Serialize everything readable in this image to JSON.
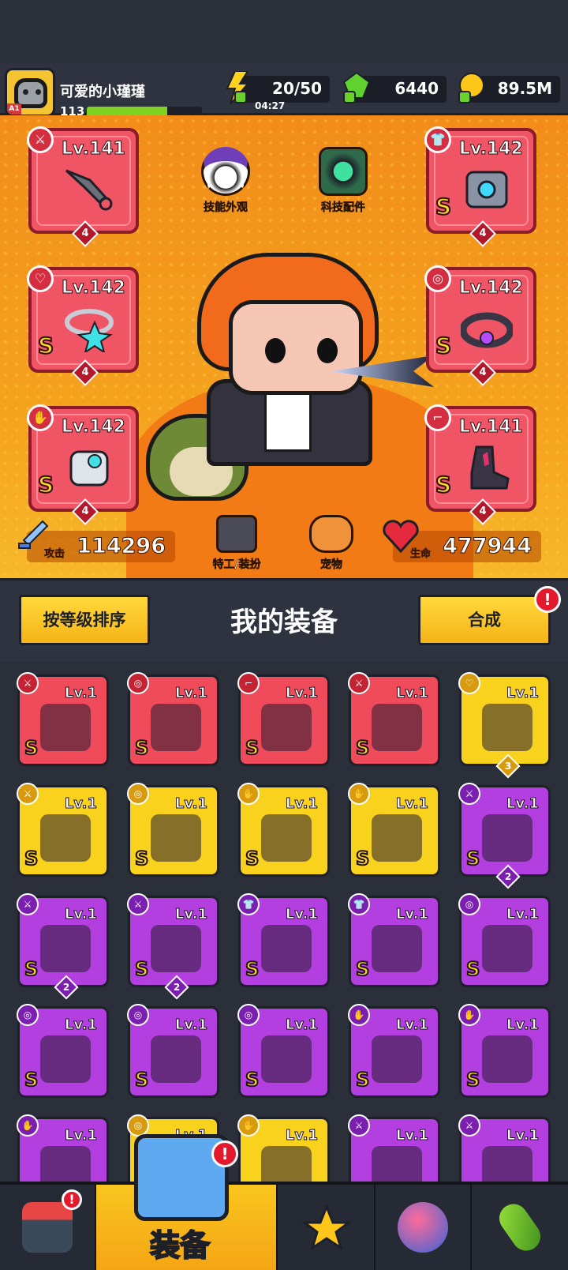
{
  "player": {
    "name": "可爱的小瑾瑾",
    "level": "113",
    "badge": "A1",
    "xp_fraction": 0.7
  },
  "resources": {
    "energy": {
      "value": "20/50",
      "timer": "04:27"
    },
    "gems": {
      "value": "6440"
    },
    "coins": {
      "value": "89.5M"
    }
  },
  "hero_buttons": {
    "skill_skin": "技能外观",
    "tech_parts": "科技配件",
    "agent_outfit": "特工/装扮",
    "pet": "宠物"
  },
  "equipped": [
    {
      "slot": "weapon",
      "level": "Lv.141",
      "stars": "4",
      "rank": ""
    },
    {
      "slot": "armor",
      "level": "Lv.142",
      "stars": "4",
      "rank": "S"
    },
    {
      "slot": "necklace",
      "level": "Lv.142",
      "stars": "4",
      "rank": "S"
    },
    {
      "slot": "belt",
      "level": "Lv.142",
      "stars": "4",
      "rank": "S"
    },
    {
      "slot": "gloves",
      "level": "Lv.142",
      "stars": "4",
      "rank": "S"
    },
    {
      "slot": "boots",
      "level": "Lv.141",
      "stars": "4",
      "rank": "S"
    }
  ],
  "stats": {
    "attack_label": "攻击",
    "attack": "114296",
    "hp_label": "生命",
    "hp": "477944"
  },
  "section": {
    "title": "我的装备",
    "sort_button": "按等级排序",
    "merge_button": "合成",
    "merge_alert": "!"
  },
  "inventory": [
    {
      "color": "red",
      "level": "Lv.1",
      "rank": "S",
      "stars": ""
    },
    {
      "color": "red",
      "level": "Lv.1",
      "rank": "S",
      "stars": ""
    },
    {
      "color": "red",
      "level": "Lv.1",
      "rank": "S",
      "stars": ""
    },
    {
      "color": "red",
      "level": "Lv.1",
      "rank": "S",
      "stars": ""
    },
    {
      "color": "yellow",
      "level": "Lv.1",
      "rank": "",
      "stars": "3"
    },
    {
      "color": "yellow",
      "level": "Lv.1",
      "rank": "S",
      "stars": ""
    },
    {
      "color": "yellow",
      "level": "Lv.1",
      "rank": "S",
      "stars": ""
    },
    {
      "color": "yellow",
      "level": "Lv.1",
      "rank": "S",
      "stars": ""
    },
    {
      "color": "yellow",
      "level": "Lv.1",
      "rank": "S",
      "stars": ""
    },
    {
      "color": "purple",
      "level": "Lv.1",
      "rank": "S",
      "stars": "2"
    },
    {
      "color": "purple",
      "level": "Lv.1",
      "rank": "S",
      "stars": "2"
    },
    {
      "color": "purple",
      "level": "Lv.1",
      "rank": "S",
      "stars": "2"
    },
    {
      "color": "purple",
      "level": "Lv.1",
      "rank": "S",
      "stars": ""
    },
    {
      "color": "purple",
      "level": "Lv.1",
      "rank": "S",
      "stars": ""
    },
    {
      "color": "purple",
      "level": "Lv.1",
      "rank": "S",
      "stars": ""
    },
    {
      "color": "purple",
      "level": "Lv.1",
      "rank": "S",
      "stars": ""
    },
    {
      "color": "purple",
      "level": "Lv.1",
      "rank": "S",
      "stars": ""
    },
    {
      "color": "purple",
      "level": "Lv.1",
      "rank": "S",
      "stars": ""
    },
    {
      "color": "purple",
      "level": "Lv.1",
      "rank": "S",
      "stars": ""
    },
    {
      "color": "purple",
      "level": "Lv.1",
      "rank": "S",
      "stars": ""
    },
    {
      "color": "purple",
      "level": "Lv.1",
      "rank": "",
      "stars": ""
    },
    {
      "color": "yellow",
      "level": "Lv.1",
      "rank": "",
      "stars": ""
    },
    {
      "color": "yellow",
      "level": "Lv.1",
      "rank": "",
      "stars": ""
    },
    {
      "color": "purple",
      "level": "Lv.1",
      "rank": "",
      "stars": ""
    },
    {
      "color": "purple",
      "level": "Lv.1",
      "rank": "",
      "stars": ""
    }
  ],
  "nav": {
    "equipment_label": "装备",
    "shop_alert": "!",
    "equipment_alert": "!"
  },
  "colors": {
    "red": "#ef4b5b",
    "yellow": "#f9d21d",
    "purple": "#b43fe0",
    "accent": "#f5a514"
  }
}
